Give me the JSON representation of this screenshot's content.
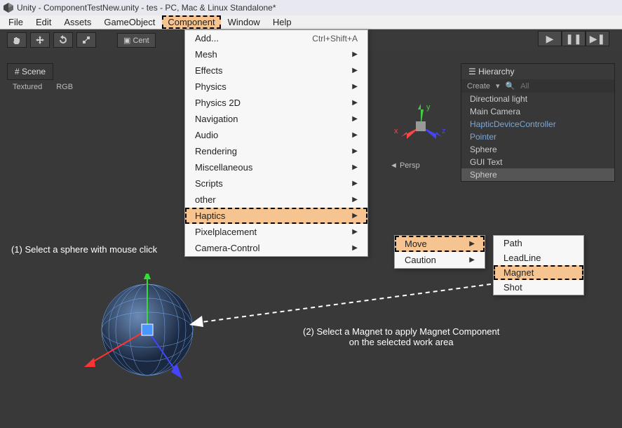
{
  "title": "Unity - ComponentTestNew.unity - tes - PC, Mac & Linux Standalone*",
  "menubar": [
    "File",
    "Edit",
    "Assets",
    "GameObject",
    "Component",
    "Window",
    "Help"
  ],
  "menubar_highlight_index": 4,
  "toolbar": {
    "center_label": "Cent"
  },
  "scene_tab": "Scene",
  "scene_sub": {
    "textured": "Textured",
    "rgb": "RGB"
  },
  "hierarchy": {
    "tab": "Hierarchy",
    "create": "Create",
    "search_placeholder": "All",
    "items": [
      {
        "label": "Directional light",
        "blue": false
      },
      {
        "label": "Main Camera",
        "blue": false
      },
      {
        "label": "HapticDeviceController",
        "blue": true
      },
      {
        "label": "Pointer",
        "blue": true
      },
      {
        "label": "Sphere",
        "blue": false
      },
      {
        "label": "GUI Text",
        "blue": false
      },
      {
        "label": "Sphere",
        "blue": false,
        "selected": true
      }
    ]
  },
  "component_menu": {
    "add": {
      "label": "Add...",
      "shortcut": "Ctrl+Shift+A"
    },
    "items": [
      "Mesh",
      "Effects",
      "Physics",
      "Physics 2D",
      "Navigation",
      "Audio",
      "Rendering",
      "Miscellaneous",
      "Scripts",
      "other",
      "Haptics",
      "Pixelplacement",
      "Camera-Control"
    ],
    "highlight": "Haptics"
  },
  "haptics_submenu": {
    "items": [
      "Move",
      "Caution"
    ],
    "highlight": "Move"
  },
  "move_submenu": {
    "items": [
      "Path",
      "LeadLine",
      "Magnet",
      "Shot"
    ],
    "highlight": "Magnet"
  },
  "gizmo": {
    "x": "x",
    "y": "y",
    "z": "z",
    "persp": "Persp"
  },
  "annot": {
    "a1": "(1) Select a sphere with mouse click",
    "a2a": "(2) Select a Magnet to apply Magnet Component",
    "a2b": "on the selected work area"
  }
}
